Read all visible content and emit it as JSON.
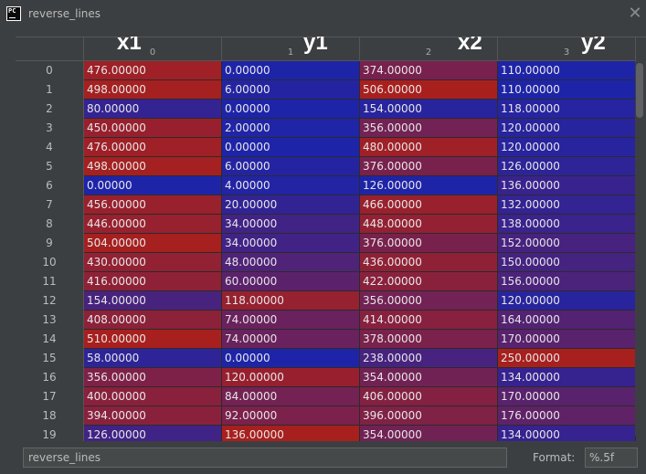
{
  "window": {
    "title": "reverse_lines",
    "app_icon_text": "PC"
  },
  "columns": [
    {
      "index": "0",
      "name": "x1"
    },
    {
      "index": "1",
      "name": "y1"
    },
    {
      "index": "2",
      "name": "x2"
    },
    {
      "index": "3",
      "name": "y2"
    }
  ],
  "rows": [
    {
      "index": "0",
      "values": [
        "476.00000",
        "0.00000",
        "374.00000",
        "110.00000"
      ]
    },
    {
      "index": "1",
      "values": [
        "498.00000",
        "6.00000",
        "506.00000",
        "110.00000"
      ]
    },
    {
      "index": "2",
      "values": [
        "80.00000",
        "0.00000",
        "154.00000",
        "118.00000"
      ]
    },
    {
      "index": "3",
      "values": [
        "450.00000",
        "2.00000",
        "356.00000",
        "120.00000"
      ]
    },
    {
      "index": "4",
      "values": [
        "476.00000",
        "0.00000",
        "480.00000",
        "120.00000"
      ]
    },
    {
      "index": "5",
      "values": [
        "498.00000",
        "6.00000",
        "376.00000",
        "126.00000"
      ]
    },
    {
      "index": "6",
      "values": [
        "0.00000",
        "4.00000",
        "126.00000",
        "136.00000"
      ]
    },
    {
      "index": "7",
      "values": [
        "456.00000",
        "20.00000",
        "466.00000",
        "132.00000"
      ]
    },
    {
      "index": "8",
      "values": [
        "446.00000",
        "34.00000",
        "448.00000",
        "138.00000"
      ]
    },
    {
      "index": "9",
      "values": [
        "504.00000",
        "34.00000",
        "376.00000",
        "152.00000"
      ]
    },
    {
      "index": "10",
      "values": [
        "430.00000",
        "48.00000",
        "436.00000",
        "150.00000"
      ]
    },
    {
      "index": "11",
      "values": [
        "416.00000",
        "60.00000",
        "422.00000",
        "156.00000"
      ]
    },
    {
      "index": "12",
      "values": [
        "154.00000",
        "118.00000",
        "356.00000",
        "120.00000"
      ]
    },
    {
      "index": "13",
      "values": [
        "408.00000",
        "74.00000",
        "414.00000",
        "164.00000"
      ]
    },
    {
      "index": "14",
      "values": [
        "510.00000",
        "74.00000",
        "378.00000",
        "170.00000"
      ]
    },
    {
      "index": "15",
      "values": [
        "58.00000",
        "0.00000",
        "238.00000",
        "250.00000"
      ]
    },
    {
      "index": "16",
      "values": [
        "356.00000",
        "120.00000",
        "354.00000",
        "134.00000"
      ]
    },
    {
      "index": "17",
      "values": [
        "400.00000",
        "84.00000",
        "406.00000",
        "170.00000"
      ]
    },
    {
      "index": "18",
      "values": [
        "394.00000",
        "92.00000",
        "396.00000",
        "176.00000"
      ]
    },
    {
      "index": "19",
      "values": [
        "126.00000",
        "136.00000",
        "354.00000",
        "134.00000"
      ]
    }
  ],
  "colors": {
    "low": "#1e24a8",
    "high": "#a8201e",
    "background": "#3c3f41"
  },
  "footer": {
    "variable_name": "reverse_lines",
    "format_label": "Format:",
    "format_value": "%.5f"
  },
  "icons": {
    "close": "close-icon",
    "app": "pycharm-icon"
  }
}
